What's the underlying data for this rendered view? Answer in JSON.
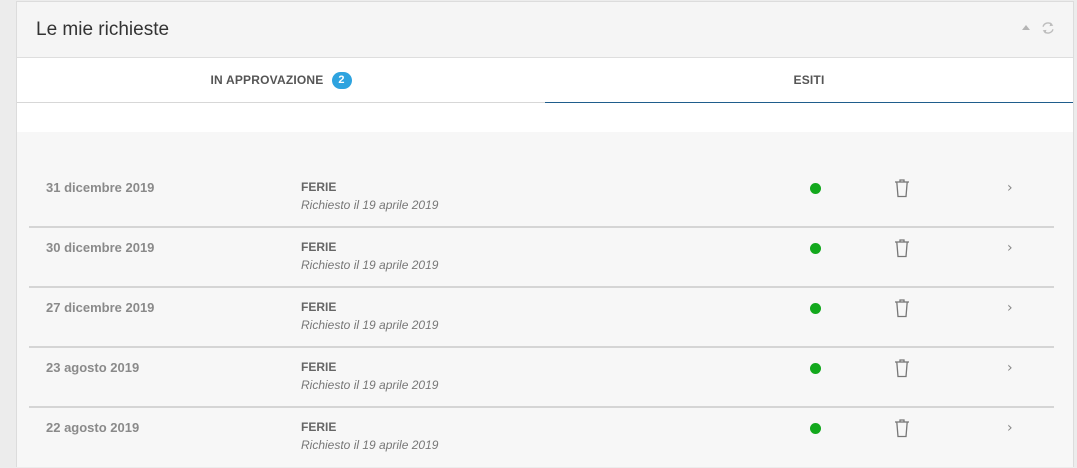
{
  "panel": {
    "title": "Le mie richieste"
  },
  "tabs": [
    {
      "label": "IN APPROVAZIONE",
      "badge": "2",
      "active": false
    },
    {
      "label": "ESITI",
      "active": true
    }
  ],
  "colors": {
    "accent": "#1f5d8c",
    "badge": "#2ea3df",
    "status_ok": "#13a81d"
  },
  "requests": [
    {
      "date": "31 dicembre 2019",
      "type": "FERIE",
      "requested": "Richiesto il 19 aprile 2019",
      "status": "approved"
    },
    {
      "date": "30 dicembre 2019",
      "type": "FERIE",
      "requested": "Richiesto il 19 aprile 2019",
      "status": "approved"
    },
    {
      "date": "27 dicembre 2019",
      "type": "FERIE",
      "requested": "Richiesto il 19 aprile 2019",
      "status": "approved"
    },
    {
      "date": "23 agosto 2019",
      "type": "FERIE",
      "requested": "Richiesto il 19 aprile 2019",
      "status": "approved"
    },
    {
      "date": "22 agosto 2019",
      "type": "FERIE",
      "requested": "Richiesto il 19 aprile 2019",
      "status": "approved"
    }
  ],
  "icons": {
    "collapse": "triangle-up-icon",
    "refresh": "refresh-icon",
    "delete": "trash-icon",
    "open": "chevron-right-icon"
  }
}
